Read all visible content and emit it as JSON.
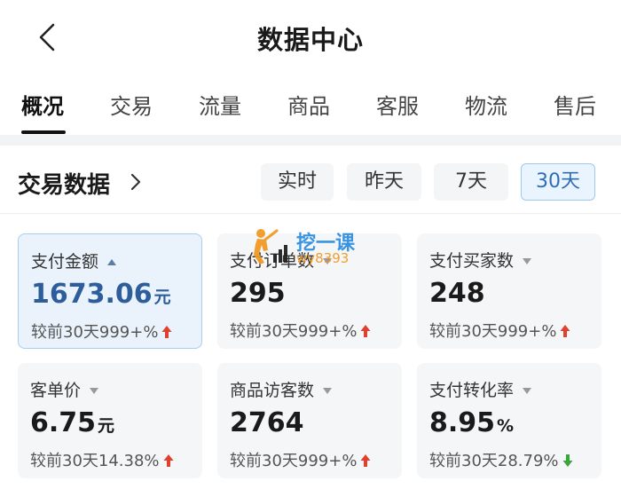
{
  "header": {
    "title": "数据中心",
    "back_icon": "chevron-left-icon"
  },
  "tabs": [
    {
      "label": "概况",
      "active": true
    },
    {
      "label": "交易",
      "active": false
    },
    {
      "label": "流量",
      "active": false
    },
    {
      "label": "商品",
      "active": false
    },
    {
      "label": "客服",
      "active": false
    },
    {
      "label": "物流",
      "active": false
    },
    {
      "label": "售后",
      "active": false
    }
  ],
  "section": {
    "title": "交易数据",
    "periods": [
      {
        "label": "实时",
        "active": false
      },
      {
        "label": "昨天",
        "active": false
      },
      {
        "label": "7天",
        "active": false
      },
      {
        "label": "30天",
        "active": true
      }
    ]
  },
  "cards": [
    {
      "label": "支付金额",
      "value": "1673.06",
      "unit": "元",
      "compare": "较前30天999+%",
      "trend": "up",
      "active": true
    },
    {
      "label": "支付订单数",
      "value": "295",
      "unit": "",
      "compare": "较前30天999+%",
      "trend": "up",
      "active": false
    },
    {
      "label": "支付买家数",
      "value": "248",
      "unit": "",
      "compare": "较前30天999+%",
      "trend": "up",
      "active": false
    },
    {
      "label": "客单价",
      "value": "6.75",
      "unit": "元",
      "compare": "较前30天14.38%",
      "trend": "up",
      "active": false
    },
    {
      "label": "商品访客数",
      "value": "2764",
      "unit": "",
      "compare": "较前30天999+%",
      "trend": "up",
      "active": false
    },
    {
      "label": "支付转化率",
      "value": "8.95",
      "unit": "%",
      "compare": "较前30天28.79%",
      "trend": "down",
      "active": false
    }
  ],
  "watermark": {
    "name": "挖一课",
    "id": "wy8393"
  },
  "colors": {
    "accent": "#2f6eb5",
    "trend_up": "#e0412f",
    "trend_down": "#3aa53a",
    "card_bg": "#f5f6f8"
  }
}
